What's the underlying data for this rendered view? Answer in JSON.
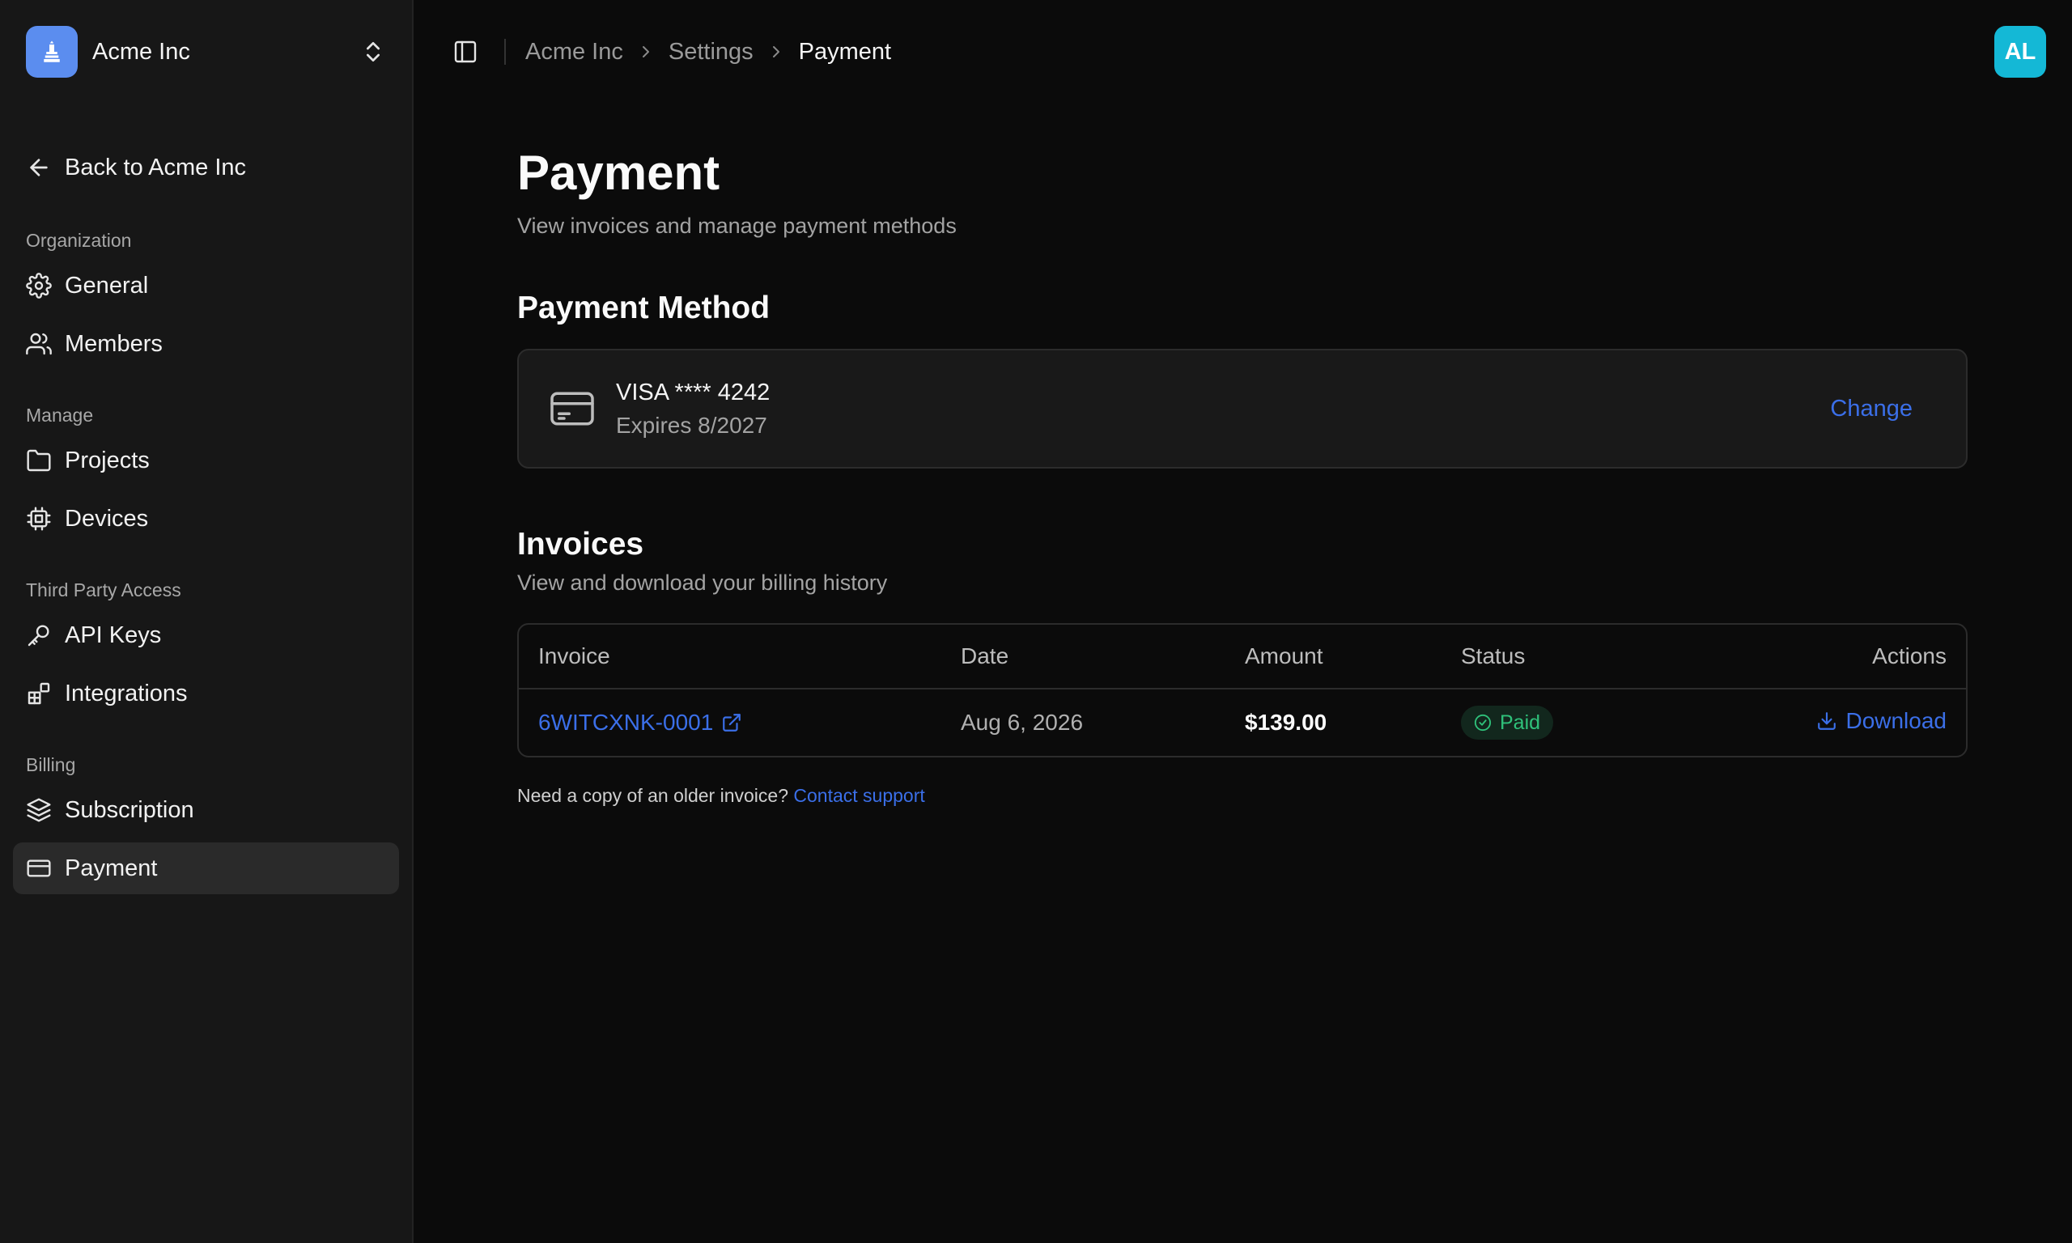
{
  "org": {
    "name": "Acme Inc"
  },
  "sidebar": {
    "back_label": "Back to Acme Inc",
    "sections": [
      {
        "label": "Organization",
        "items": [
          {
            "label": "General",
            "icon": "gear-icon"
          },
          {
            "label": "Members",
            "icon": "users-icon"
          }
        ]
      },
      {
        "label": "Manage",
        "items": [
          {
            "label": "Projects",
            "icon": "folder-icon"
          },
          {
            "label": "Devices",
            "icon": "chip-icon"
          }
        ]
      },
      {
        "label": "Third Party Access",
        "items": [
          {
            "label": "API Keys",
            "icon": "key-icon"
          },
          {
            "label": "Integrations",
            "icon": "blocks-icon"
          }
        ]
      },
      {
        "label": "Billing",
        "items": [
          {
            "label": "Subscription",
            "icon": "layers-icon"
          },
          {
            "label": "Payment",
            "icon": "credit-card-icon",
            "active": true
          }
        ]
      }
    ]
  },
  "breadcrumb": [
    "Acme Inc",
    "Settings",
    "Payment"
  ],
  "user": {
    "initials": "AL"
  },
  "page": {
    "title": "Payment",
    "subtitle": "View invoices and manage payment methods"
  },
  "payment_method": {
    "title": "Payment Method",
    "card": "VISA **** 4242",
    "expires": "Expires 8/2027",
    "change_label": "Change"
  },
  "invoices": {
    "title": "Invoices",
    "subtitle": "View and download your billing history",
    "columns": [
      "Invoice",
      "Date",
      "Amount",
      "Status",
      "Actions"
    ],
    "rows": [
      {
        "id": "6WITCXNK-0001",
        "date": "Aug 6, 2026",
        "amount": "$139.00",
        "status": "Paid",
        "action": "Download"
      }
    ],
    "footnote": "Need a copy of an older invoice?",
    "contact_label": "Contact support"
  },
  "colors": {
    "accent": "#3b6fe8",
    "paid": "#2fc17a",
    "avatar": "#14b8d6",
    "org_logo": "#5b8def"
  }
}
